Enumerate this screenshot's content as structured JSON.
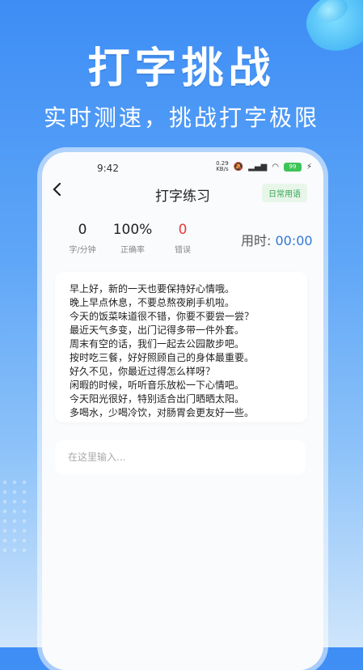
{
  "banner": {
    "title": "打字挑战",
    "subtitle": "实时测速，挑战打字极限"
  },
  "status_bar": {
    "time": "9:42",
    "net_speed_value": "0.29",
    "net_speed_unit": "KB/s",
    "battery": "99"
  },
  "nav": {
    "back_icon": "chevron-left-icon",
    "title": "打字练习",
    "category_chip": "日常用语"
  },
  "stats": {
    "speed_value": "0",
    "speed_label": "字/分钟",
    "accuracy_value": "100%",
    "accuracy_label": "正确率",
    "errors_value": "0",
    "errors_label": "错误",
    "timer_label": "用时: ",
    "timer_value": "00:00"
  },
  "practice_text": [
    "早上好，新的一天也要保持好心情哦。",
    "晚上早点休息，不要总熬夜刷手机啦。",
    "今天的饭菜味道很不错，你要不要尝一尝？",
    "最近天气多变，出门记得多带一件外套。",
    "周末有空的话，我们一起去公园散步吧。",
    "按时吃三餐，好好照顾自己的身体最重要。",
    "好久不见，你最近过得怎么样呀？",
    "闲暇的时候，听听音乐放松一下心情吧。",
    "今天阳光很好，特别适合出门晒晒太阳。",
    "多喝水，少喝冷饮，对肠胃会更友好一些。"
  ],
  "input": {
    "placeholder": "在这里输入...",
    "value": ""
  },
  "colors": {
    "accent": "#3177d8",
    "error": "#e23c3c",
    "chip_text": "#36a552"
  }
}
